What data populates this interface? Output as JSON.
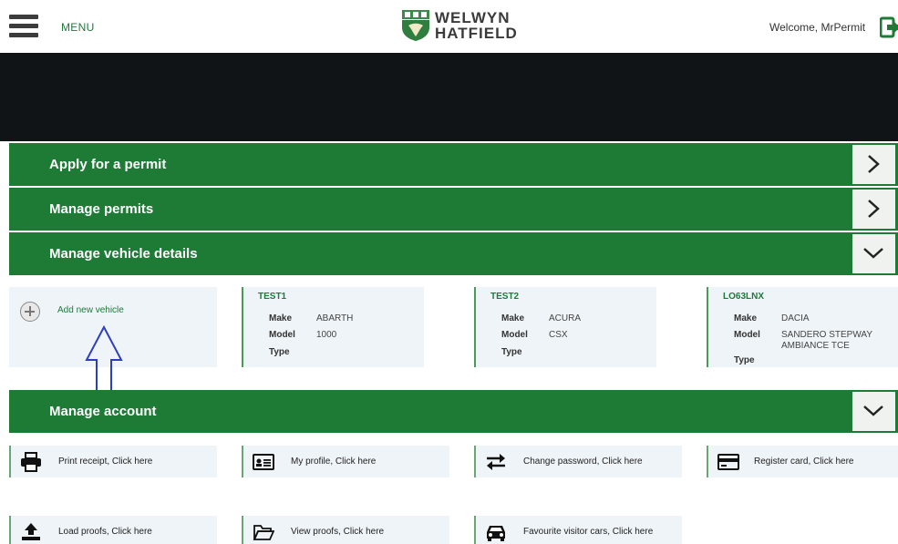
{
  "header": {
    "menu_label": "MENU",
    "logo_line1": "WELWYN",
    "logo_line2": "HATFIELD",
    "welcome": "Welcome, MrPermit"
  },
  "sections": {
    "apply": "Apply for a permit",
    "manage_permits": "Manage permits",
    "manage_vehicles": "Manage vehicle details",
    "manage_account": "Manage account"
  },
  "vehicles": {
    "add_label": "Add new vehicle",
    "labels": {
      "make": "Make",
      "model": "Model",
      "type": "Type"
    },
    "items": [
      {
        "reg": "TEST1",
        "make": "ABARTH",
        "model": "1000",
        "model_line2": "",
        "type": ""
      },
      {
        "reg": "TEST2",
        "make": "ACURA",
        "model": "CSX",
        "model_line2": "",
        "type": ""
      },
      {
        "reg": "LO63LNX",
        "make": "DACIA",
        "model": "SANDERO STEPWAY",
        "model_line2": "AMBIANCE TCE",
        "type": ""
      }
    ]
  },
  "account": {
    "print_receipt": "Print receipt, Click here",
    "my_profile": "My profile, Click here",
    "change_password": "Change password, Click here",
    "register_card": "Register card, Click here",
    "load_proofs": "Load proofs, Click here",
    "view_proofs": "View proofs, Click here",
    "favourite_cars": "Favourite visitor cars, Click here"
  },
  "colors": {
    "green": "#1e7b35",
    "banner": "#111417",
    "card_bg": "#eef4f8",
    "arrow": "#2d3fbf"
  },
  "icons": {
    "menu": "hamburger-icon",
    "logout": "logout-icon",
    "add": "plus-circle-icon",
    "print": "printer-icon",
    "profile": "id-card-icon",
    "password": "swap-arrows-icon",
    "card": "credit-card-icon",
    "upload": "upload-icon",
    "folder": "folder-icon",
    "car": "car-icon",
    "chevron_right": "chevron-right-icon",
    "chevron_down": "chevron-down-icon"
  }
}
